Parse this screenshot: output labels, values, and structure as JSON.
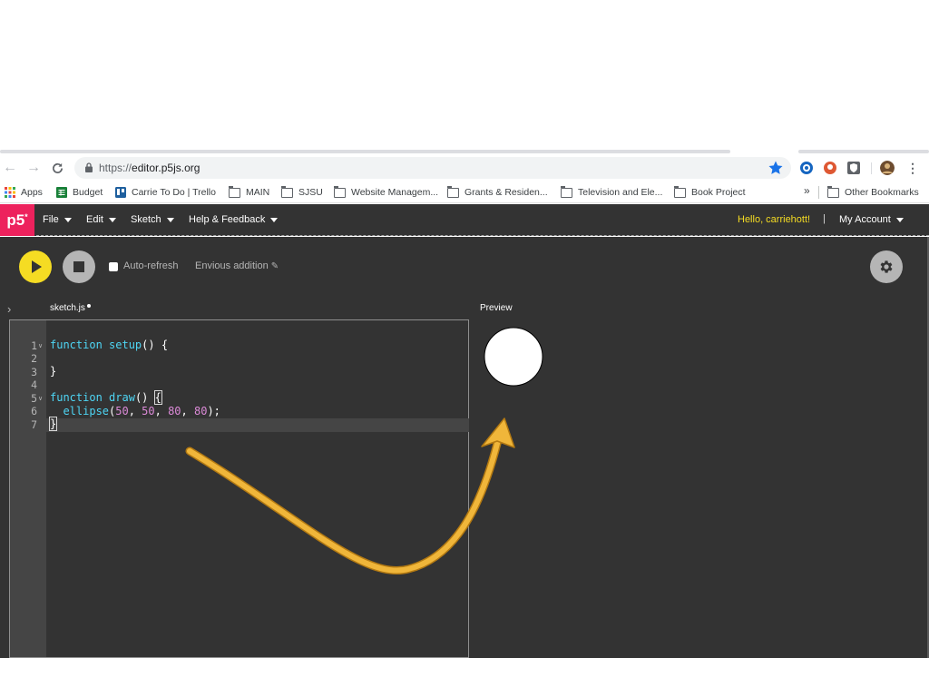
{
  "browser": {
    "url_scheme": "https://",
    "url_host": "editor.p5js.org",
    "bookmarks": [
      {
        "label": "Apps",
        "icon": "apps-grid-icon"
      },
      {
        "label": "Budget",
        "icon": "sheets-icon"
      },
      {
        "label": "Carrie To Do | Trello",
        "icon": "trello-icon"
      },
      {
        "label": "MAIN",
        "icon": "folder-icon"
      },
      {
        "label": "SJSU",
        "icon": "folder-icon"
      },
      {
        "label": "Website Managem...",
        "icon": "folder-icon"
      },
      {
        "label": "Grants & Residen...",
        "icon": "folder-icon"
      },
      {
        "label": "Television and Ele...",
        "icon": "folder-icon"
      },
      {
        "label": "Book Project",
        "icon": "folder-icon"
      }
    ],
    "more_bookmarks": "»",
    "other_bookmarks": "Other Bookmarks",
    "colors": {
      "star": "#1a73e8"
    }
  },
  "editor": {
    "logo": "p5",
    "logo_sup": "*",
    "menus": [
      "File",
      "Edit",
      "Sketch",
      "Help & Feedback"
    ],
    "greeting": "Hello, carriehott!",
    "divider": "|",
    "account": "My Account",
    "auto_refresh": "Auto-refresh",
    "sketch_name": "Envious addition",
    "file_tab": "sketch.js",
    "preview_label": "Preview",
    "line_numbers": [
      "1",
      "2",
      "3",
      "4",
      "5",
      "6",
      "7"
    ],
    "colors": {
      "accent": "#ed225d",
      "play": "#f5dc23",
      "arrow": "#f0b63a"
    }
  }
}
